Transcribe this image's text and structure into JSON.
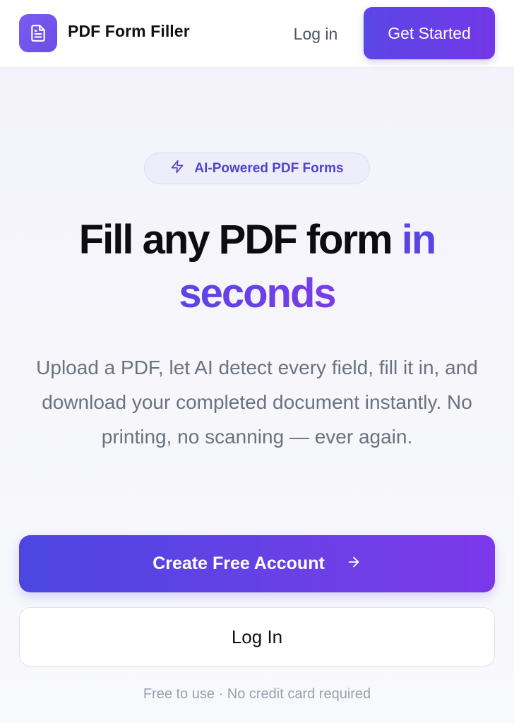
{
  "header": {
    "brand": "PDF Form Filler",
    "login_label": "Log in",
    "cta_label": "Get Started",
    "logo_icon": "document-icon"
  },
  "hero": {
    "badge": {
      "icon": "lightning-icon",
      "label": "AI-Powered PDF Forms"
    },
    "headline_main": "Fill any PDF form",
    "headline_accent_1": "in",
    "headline_accent_2": "seconds",
    "subtitle": "Upload a PDF, let AI detect every field, fill it in, and download your completed document instantly. No printing, no scanning — ever again.",
    "primary_cta": {
      "label": "Create Free Account",
      "icon": "arrow-right-icon"
    },
    "secondary_cta": {
      "label": "Log In"
    },
    "footnote": "Free to use · No credit card required"
  },
  "colors": {
    "accent": "#5a45e4",
    "accent_end": "#7a3ce8",
    "text_dark": "#0d0d10",
    "text_muted": "#6b7280"
  }
}
